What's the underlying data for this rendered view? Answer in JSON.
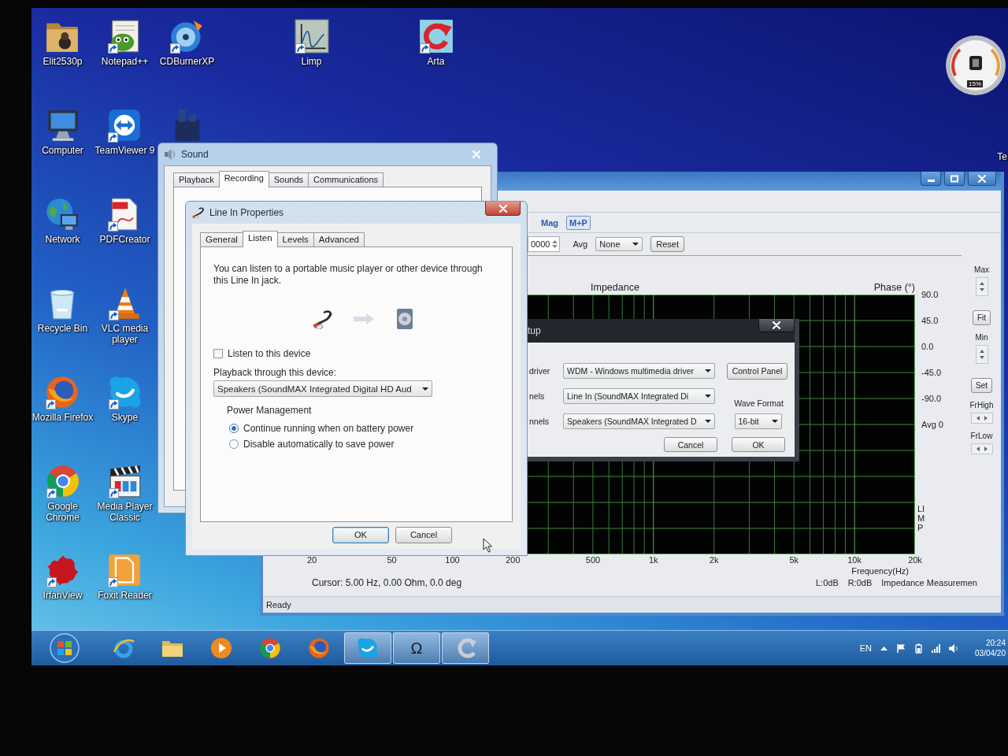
{
  "desktop": {
    "icons": [
      {
        "label": "Elit2530p",
        "kind": "folder",
        "shortcut": false
      },
      {
        "label": "Notepad++",
        "kind": "notepad",
        "shortcut": true
      },
      {
        "label": "CDBurnerXP",
        "kind": "disc",
        "shortcut": true
      },
      {
        "label": "Limp",
        "kind": "graph",
        "shortcut": true
      },
      {
        "label": "Arta",
        "kind": "circular_arrow",
        "shortcut": true
      },
      {
        "label": "Computer",
        "kind": "computer",
        "shortcut": false
      },
      {
        "label": "TeamViewer 9",
        "kind": "teamviewer",
        "shortcut": true
      },
      {
        "kind": "program",
        "shortcut": false
      },
      {
        "label": "Te",
        "kind": "edge"
      },
      {
        "label": "Network",
        "kind": "network",
        "shortcut": false
      },
      {
        "label": "PDFCreator",
        "kind": "pdf",
        "shortcut": true
      },
      {
        "label": "Recycle Bin",
        "kind": "recycle",
        "shortcut": false
      },
      {
        "label": "VLC media player",
        "kind": "cone",
        "shortcut": true
      },
      {
        "label": "Mozilla Firefox",
        "kind": "firefox",
        "shortcut": true
      },
      {
        "label": "Skype",
        "kind": "skype",
        "shortcut": true
      },
      {
        "label": "Google Chrome",
        "kind": "chrome",
        "shortcut": true
      },
      {
        "label": "Media Player Classic",
        "kind": "clapper",
        "shortcut": true
      },
      {
        "label": "IrfanView",
        "kind": "splash",
        "shortcut": true
      },
      {
        "label": "Foxit Reader",
        "kind": "foxit",
        "shortcut": true
      }
    ]
  },
  "gadget": {
    "reading": "15%"
  },
  "measurement_window": {
    "view_buttons": [
      {
        "label": "Mag",
        "selected": false
      },
      {
        "label": "M+P",
        "selected": true
      }
    ],
    "points_field": {
      "value": "0000"
    },
    "averaging": {
      "label": "Avg",
      "value": "None"
    },
    "reset_button": "Reset",
    "plot": {
      "title": "Impedance",
      "phase_label": "Phase (°)",
      "phase_ticks": [
        "90.0",
        "45.0",
        "0.0",
        "-45.0",
        "-90.0"
      ],
      "average": "Avg 0",
      "side_letters": "LIMP",
      "freq_ticks": [
        "20",
        "50",
        "100",
        "200",
        "500",
        "1k",
        "2k",
        "5k",
        "10k",
        "20k"
      ],
      "xlabel": "Frequency(Hz)"
    },
    "side_panel": [
      {
        "kind": "label",
        "text": "Max"
      },
      {
        "kind": "spinner"
      },
      {
        "kind": "button",
        "text": "Fit"
      },
      {
        "kind": "label",
        "text": "Min"
      },
      {
        "kind": "spinner"
      },
      {
        "kind": "button",
        "text": "Set"
      },
      {
        "kind": "label",
        "text": "FrHigh"
      },
      {
        "kind": "stepper"
      },
      {
        "kind": "label",
        "text": "FrLow"
      },
      {
        "kind": "stepper"
      }
    ],
    "cursor": "Cursor: 5.00 Hz, 0.00 Ohm, 0.0 deg",
    "channel_levels": [
      "L:0dB",
      "R:0dB"
    ],
    "mode": "Impedance Measuremen",
    "status": "Ready"
  },
  "setup_dialog": {
    "title": "tup",
    "rows": [
      {
        "label": "driver",
        "value": "WDM - Windows multimedia driver"
      },
      {
        "label": "nels",
        "value": "Line In (SoundMAX Integrated Di"
      },
      {
        "label": "nnels",
        "value": "Speakers (SoundMAX Integrated D"
      }
    ],
    "control_panel_button": "Control Panel",
    "wave_format": {
      "label": "Wave Format",
      "value": "16-bit"
    },
    "buttons": [
      "Cancel",
      "OK"
    ]
  },
  "sound_window": {
    "title": "Sound",
    "tabs": [
      {
        "label": "Playback",
        "selected": false
      },
      {
        "label": "Recording",
        "selected": true
      },
      {
        "label": "Sounds",
        "selected": false
      },
      {
        "label": "Communications",
        "selected": false
      }
    ]
  },
  "line_in_dialog": {
    "title": "Line In Properties",
    "tabs": [
      {
        "label": "General",
        "selected": false
      },
      {
        "label": "Listen",
        "selected": true
      },
      {
        "label": "Levels",
        "selected": false
      },
      {
        "label": "Advanced",
        "selected": false
      }
    ],
    "description": "You can listen to a portable music player or other device through this Line In jack.",
    "listen_checkbox": {
      "label": "Listen to this device",
      "checked": false
    },
    "playback_label": "Playback through this device:",
    "playback_device": {
      "value": "Speakers (SoundMAX Integrated Digital HD Aud"
    },
    "power_management": {
      "title": "Power Management",
      "options": [
        {
          "label": "Continue running when on battery power",
          "selected": true
        },
        {
          "label": "Disable automatically to save power",
          "selected": false
        }
      ]
    },
    "buttons": [
      {
        "label": "OK",
        "default": true
      },
      {
        "label": "Cancel",
        "default": false
      }
    ]
  },
  "taskbar": {
    "items": [
      {
        "kind": "ie",
        "active": false
      },
      {
        "kind": "folder",
        "active": false
      },
      {
        "kind": "media",
        "active": false
      },
      {
        "kind": "chrome",
        "active": false
      },
      {
        "kind": "firefox",
        "active": false
      },
      {
        "kind": "skype",
        "active": true
      },
      {
        "kind": "glyph",
        "label": "Ω",
        "active": true
      },
      {
        "kind": "arta",
        "active": true
      }
    ],
    "language": "EN",
    "clock": {
      "time": "20:24",
      "date": "03/04/20"
    }
  }
}
